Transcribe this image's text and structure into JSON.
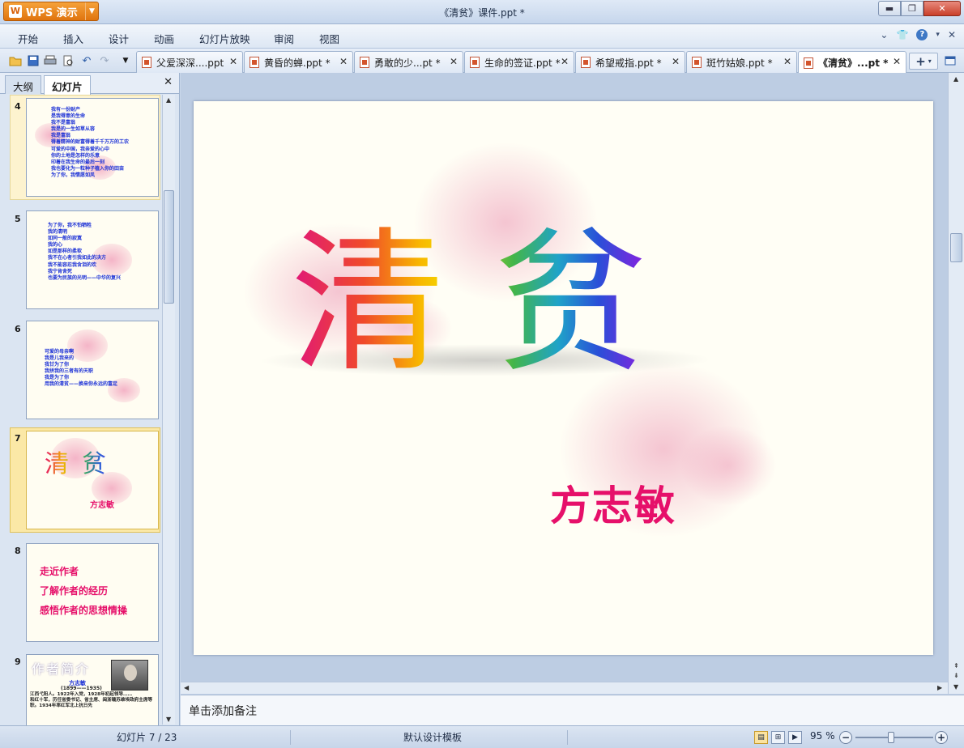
{
  "app": {
    "brand": "WPS 演示",
    "window_title": "《清贫》课件.ppt *"
  },
  "menu": [
    "开始",
    "插入",
    "设计",
    "动画",
    "幻灯片放映",
    "审阅",
    "视图"
  ],
  "tabs": [
    {
      "label": "父爱深深....ppt",
      "active": false
    },
    {
      "label": "黄昏的蝉.ppt *",
      "active": false
    },
    {
      "label": "勇敢的少...pt *",
      "active": false
    },
    {
      "label": "生命的签证.ppt *",
      "active": false
    },
    {
      "label": "希望戒指.ppt *",
      "active": false
    },
    {
      "label": "斑竹姑娘.ppt *",
      "active": false
    },
    {
      "label": "《清贫》...pt *",
      "active": true
    }
  ],
  "left_panel": {
    "tabs": [
      "大纲",
      "幻灯片"
    ],
    "active_tab": "幻灯片",
    "thumbnails": [
      {
        "num": "4",
        "text": "我有一份财产\n是我得意的生命\n我不是富翁\n我是的一生如草从容\n我是富翁\n得着精神的财富得着千千万万的工农\n可爱的中国，我亲爱的心中\n你的土地是怎样的乐意\n印着在我生命的最后一刻\n我也要化为一粒种子植入你的田亩\n为了你，我情愿如风"
      },
      {
        "num": "5",
        "text": "为了你，我不怕牺牲\n我的清明\n如同一般的寂寞\n我的心\n如是那样的柔软\n我不在心者引我如此的决方\n我不能容忍我含泪的欢\n我宁肯舍死\n也要为民族的光明——中华的复兴"
      },
      {
        "num": "6",
        "text": "可爱的母亲啊\n我是儿我来的\n我甘为了你\n我拼我的三者有的天职\n我是为了你\n用我的清贫——换来你永远的富足"
      },
      {
        "num": "7",
        "title": "清贫",
        "author": "方志敏",
        "selected": true
      },
      {
        "num": "8",
        "lines": [
          "走近作者",
          "了解作者的经历",
          "感悟作者的思想情操"
        ]
      },
      {
        "num": "9",
        "title": "作者简介",
        "name": "方志敏",
        "years": "(1899——1935)",
        "text": "江西弋阳人。1922年入党，1928年初起领导……\n和红十军，历任省委书记、省主席、闽浙赣苏维埃政府主席等职。1934年率红军北上抗日先"
      }
    ]
  },
  "slide": {
    "title": "清贫",
    "author": "方志敏"
  },
  "notes_placeholder": "单击添加备注",
  "status": {
    "slide_info": "幻灯片 7 / 23",
    "template": "默认设计模板",
    "zoom": "95 %"
  },
  "colors": {
    "author_pink": "#e6106a",
    "title_bar": "#dfe9f6",
    "wps_orange": "#e87a12"
  }
}
